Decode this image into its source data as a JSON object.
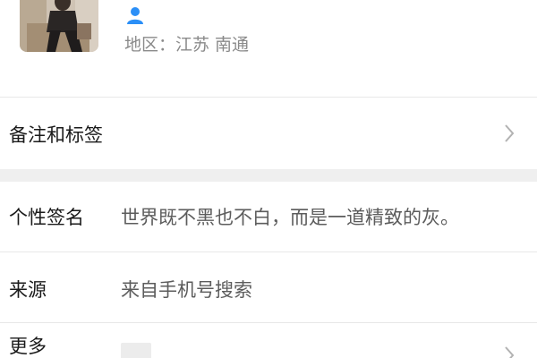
{
  "profile": {
    "avatar": "avatar-photo",
    "contact_icon": "person-icon",
    "region": "地区：江苏 南通"
  },
  "rows": {
    "remark_tags": {
      "label": "备注和标签"
    },
    "signature": {
      "label": "个性签名",
      "value": "世界既不黑也不白，而是一道精致的灰。"
    },
    "source": {
      "label": "来源",
      "value": "来自手机号搜索"
    },
    "more": {
      "label": "更多"
    }
  },
  "colors": {
    "accent": "#2b8ff7",
    "text_primary": "#1a1a1a",
    "text_secondary": "#8a8a8a",
    "section_gap": "#efefef"
  }
}
